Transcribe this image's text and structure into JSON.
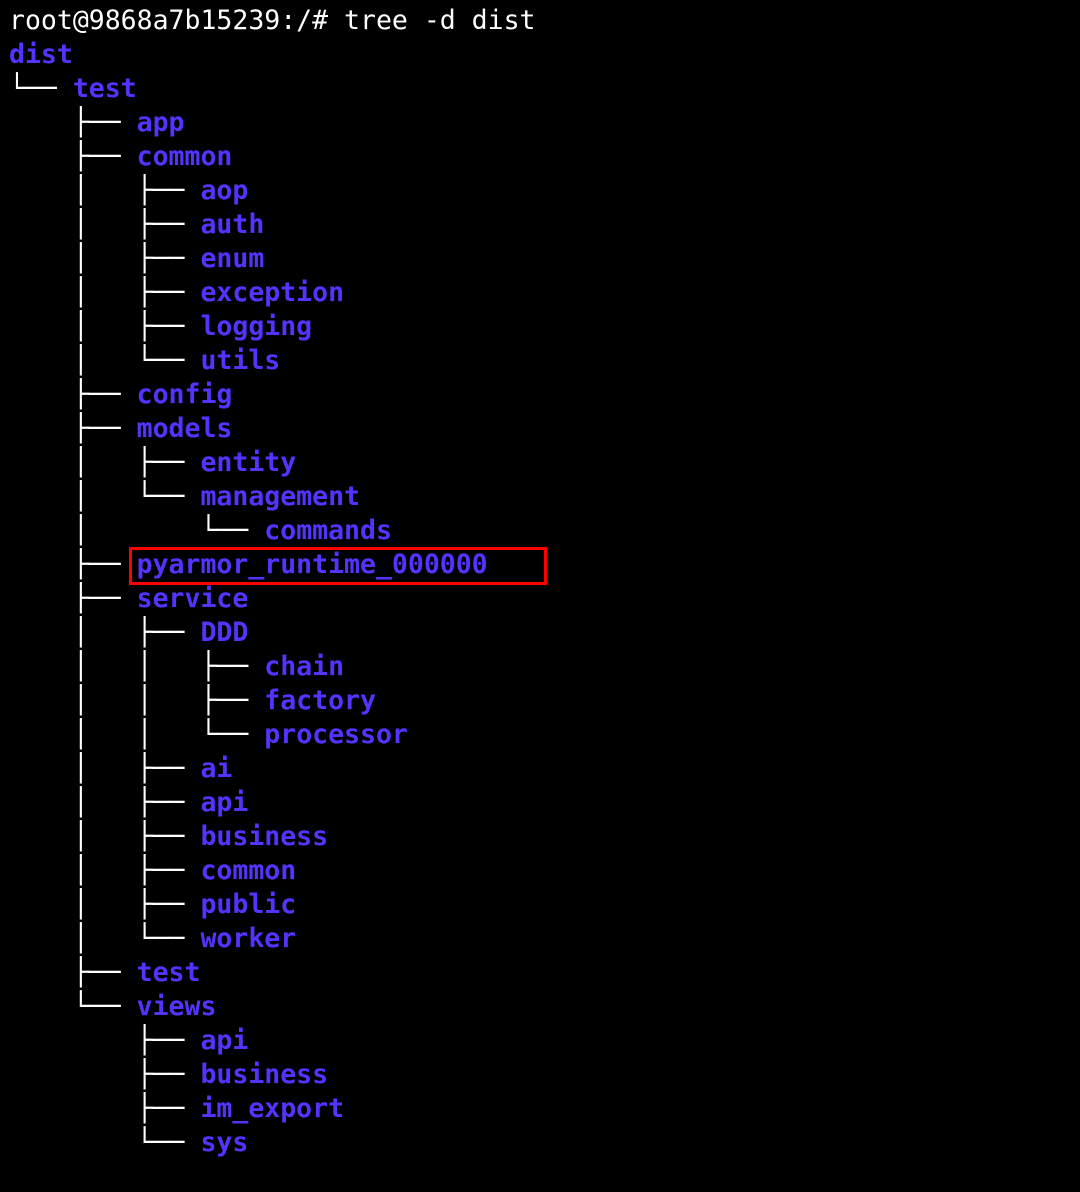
{
  "terminal": {
    "prompt": "root@9868a7b15239:/# ",
    "command": "tree -d dist",
    "colors": {
      "background": "#000000",
      "text": "#ffffff",
      "directory": "#5533ff",
      "highlight": "#ff0000"
    },
    "tree": [
      {
        "prefix": "",
        "name": "dist"
      },
      {
        "prefix": "└── ",
        "name": "test"
      },
      {
        "prefix": "    ├── ",
        "name": "app"
      },
      {
        "prefix": "    ├── ",
        "name": "common"
      },
      {
        "prefix": "    │   ├── ",
        "name": "aop"
      },
      {
        "prefix": "    │   ├── ",
        "name": "auth"
      },
      {
        "prefix": "    │   ├── ",
        "name": "enum"
      },
      {
        "prefix": "    │   ├── ",
        "name": "exception"
      },
      {
        "prefix": "    │   ├── ",
        "name": "logging"
      },
      {
        "prefix": "    │   └── ",
        "name": "utils"
      },
      {
        "prefix": "    ├── ",
        "name": "config"
      },
      {
        "prefix": "    ├── ",
        "name": "models"
      },
      {
        "prefix": "    │   ├── ",
        "name": "entity"
      },
      {
        "prefix": "    │   └── ",
        "name": "management"
      },
      {
        "prefix": "    │       └── ",
        "name": "commands"
      },
      {
        "prefix": "    ├── ",
        "name": "pyarmor_runtime_000000",
        "highlighted": true
      },
      {
        "prefix": "    ├── ",
        "name": "service"
      },
      {
        "prefix": "    │   ├── ",
        "name": "DDD"
      },
      {
        "prefix": "    │   │   ├── ",
        "name": "chain"
      },
      {
        "prefix": "    │   │   ├── ",
        "name": "factory"
      },
      {
        "prefix": "    │   │   └── ",
        "name": "processor"
      },
      {
        "prefix": "    │   ├── ",
        "name": "ai"
      },
      {
        "prefix": "    │   ├── ",
        "name": "api"
      },
      {
        "prefix": "    │   ├── ",
        "name": "business"
      },
      {
        "prefix": "    │   ├── ",
        "name": "common"
      },
      {
        "prefix": "    │   ├── ",
        "name": "public"
      },
      {
        "prefix": "    │   └── ",
        "name": "worker"
      },
      {
        "prefix": "    ├── ",
        "name": "test"
      },
      {
        "prefix": "    └── ",
        "name": "views"
      },
      {
        "prefix": "        ├── ",
        "name": "api"
      },
      {
        "prefix": "        ├── ",
        "name": "business"
      },
      {
        "prefix": "        ├── ",
        "name": "im_export"
      },
      {
        "prefix": "        └── ",
        "name": "sys"
      }
    ]
  }
}
